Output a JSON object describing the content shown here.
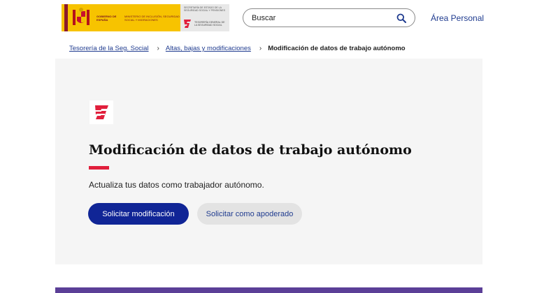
{
  "header": {
    "logo": {
      "gov_text": "GOBIERNO DE ESPAÑA",
      "ministry_text": "MINISTERIO DE INCLUSIÓN, SEGURIDAD SOCIAL Y MIGRACIONES",
      "secretaria_text": "SECRETARÍA DE ESTADO DE LA SEGURIDAD SOCIAL Y PENSIONES",
      "tgss_text": "TESORERÍA GENERAL DE LA SEGURIDAD SOCIAL",
      "gov_color": "#f7c300",
      "tgss_color": "#e11f3c"
    },
    "search": {
      "placeholder": "Buscar",
      "icon": "search-icon"
    },
    "account_link": "Área Personal"
  },
  "breadcrumb": {
    "items": [
      "Tesorería de la Seg. Social",
      "Altas, bajas y modificaciones"
    ],
    "current": "Modificación de datos de trabajo autónomo",
    "separator": "›"
  },
  "hero": {
    "title": "Modificación de datos de trabajo autónomo",
    "description": "Actualiza tus datos como trabajador autónomo.",
    "primary_button": "Solicitar modificación",
    "secondary_button": "Solicitar como apoderado",
    "accent_color": "#e11f3c",
    "primary_color": "#102596"
  }
}
